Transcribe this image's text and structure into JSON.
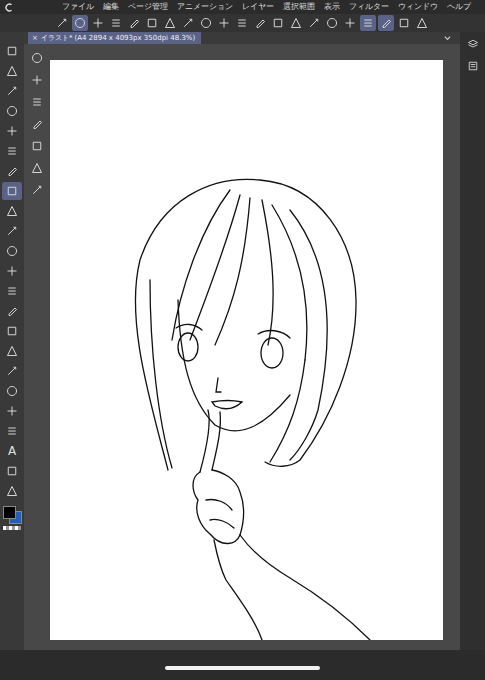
{
  "menu": {
    "items": [
      "ファイル",
      "編集",
      "ページ管理",
      "アニメーション",
      "レイヤー",
      "選択範囲",
      "表示",
      "フィルター",
      "ウィンドウ",
      "ヘルプ"
    ]
  },
  "toolbar": [
    {
      "selected": false
    },
    {
      "selected": true
    },
    {
      "selected": false
    },
    {
      "selected": false
    },
    {
      "selected": false
    },
    {
      "selected": false
    },
    {
      "selected": false
    },
    {
      "selected": false
    },
    {
      "selected": false
    },
    {
      "selected": false
    },
    {
      "selected": false
    },
    {
      "selected": false
    },
    {
      "selected": false
    },
    {
      "selected": false
    },
    {
      "selected": false
    },
    {
      "selected": false
    },
    {
      "selected": false
    },
    {
      "selected": true
    },
    {
      "selected": true
    },
    {
      "selected": false
    },
    {
      "selected": false
    }
  ],
  "document_tab": {
    "close": "×",
    "title": "イラスト* (A4 2894 x 4093px 350dpi 48.3%)"
  },
  "tools": [
    {
      "selected": false
    },
    {
      "selected": false
    },
    {
      "selected": false
    },
    {
      "selected": false
    },
    {
      "selected": false
    },
    {
      "selected": false
    },
    {
      "selected": false
    },
    {
      "selected": true
    },
    {
      "selected": false
    },
    {
      "selected": false
    },
    {
      "selected": false
    },
    {
      "selected": false
    },
    {
      "selected": false
    },
    {
      "selected": false
    },
    {
      "selected": false
    },
    {
      "selected": false
    },
    {
      "selected": false
    },
    {
      "selected": false
    },
    {
      "selected": false
    },
    {
      "selected": false
    },
    {
      "selected": false,
      "glyph": "A"
    },
    {
      "selected": false
    },
    {
      "selected": false
    }
  ],
  "subtools": [
    {
      "selected": false
    },
    {
      "selected": false
    },
    {
      "selected": false
    },
    {
      "selected": false
    },
    {
      "selected": false
    },
    {
      "selected": false
    },
    {
      "selected": false
    }
  ],
  "colors": [
    {
      "color": "#000000",
      "selected": true
    },
    {
      "color": "#1f5fbf",
      "selected": false
    }
  ],
  "right_panel": [
    {
      "selected": false
    },
    {
      "selected": false
    }
  ]
}
